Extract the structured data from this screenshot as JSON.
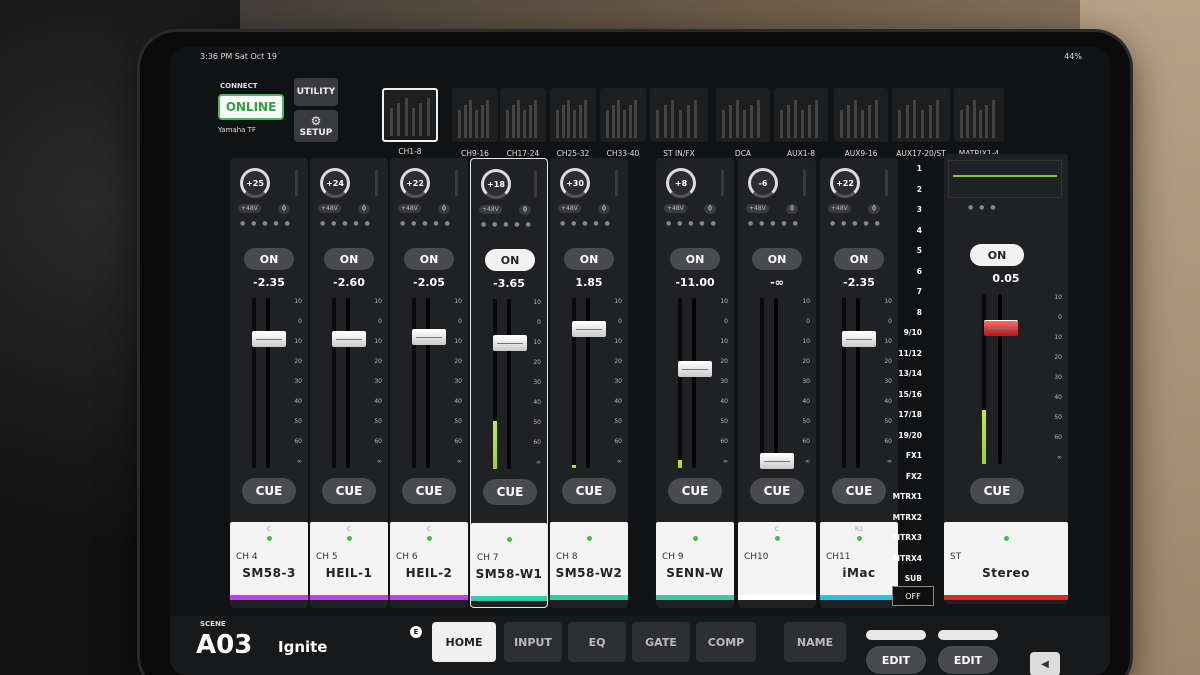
{
  "status": {
    "time": "3:36 PM  Sat Oct 19",
    "battery": "44%"
  },
  "connect": {
    "label": "CONNECT",
    "status": "ONLINE",
    "device": "Yamaha TF"
  },
  "buttons": {
    "utility": "UTILITY",
    "setup": "SETUP"
  },
  "banks": [
    "CH1-8",
    "CH9-16",
    "CH17-24",
    "CH25-32",
    "CH33-40",
    "ST IN/FX",
    "DCA",
    "AUX1-8",
    "AUX9-16",
    "AUX17-20/ST",
    "MATRIX1-4"
  ],
  "channels": [
    {
      "gain": "+25",
      "on": "ON",
      "level": "-2.35",
      "cue": "CUE",
      "pan": "C",
      "num": "CH 4",
      "name": "SM58-3",
      "color": "#c040ff",
      "fader": 0.76,
      "meter": 0.0
    },
    {
      "gain": "+24",
      "on": "ON",
      "level": "-2.60",
      "cue": "CUE",
      "pan": "C",
      "num": "CH 5",
      "name": "HEIL-1",
      "color": "#c040ff",
      "fader": 0.76,
      "meter": 0.0
    },
    {
      "gain": "+22",
      "on": "ON",
      "level": "-2.05",
      "cue": "CUE",
      "pan": "C",
      "num": "CH 6",
      "name": "HEIL-2",
      "color": "#c040ff",
      "fader": 0.77,
      "meter": 0.0
    },
    {
      "gain": "+18",
      "on": "ON",
      "level": "-3.65",
      "cue": "CUE",
      "pan": "",
      "num": "CH 7",
      "name": "SM58-W1",
      "color": "#2fd0a8",
      "fader": 0.74,
      "meter": 0.28
    },
    {
      "gain": "+30",
      "on": "ON",
      "level": "1.85",
      "cue": "CUE",
      "pan": "",
      "num": "CH 8",
      "name": "SM58-W2",
      "color": "#2fd0a8",
      "fader": 0.82,
      "meter": 0.02
    },
    {
      "gain": "+8",
      "on": "ON",
      "level": "-11.00",
      "cue": "CUE",
      "pan": "",
      "num": "CH 9",
      "name": "SENN-W",
      "color": "#2fd0a8",
      "fader": 0.58,
      "meter": 0.05
    },
    {
      "gain": "-6",
      "on": "ON",
      "level": "-∞",
      "cue": "CUE",
      "pan": "C",
      "num": "CH10",
      "name": "",
      "color": "#ffffff",
      "fader": 0.04,
      "meter": 0.0
    },
    {
      "gain": "+22",
      "on": "ON",
      "level": "-2.35",
      "cue": "CUE",
      "pan": "R2",
      "num": "CH11",
      "name": "iMac",
      "color": "#27c6e0",
      "fader": 0.76,
      "meter": 0.0
    }
  ],
  "phantom": "+48V",
  "scale": [
    "10",
    "0",
    "10",
    "20",
    "30",
    "40",
    "50",
    "60",
    "∞"
  ],
  "sends": [
    "1",
    "2",
    "3",
    "4",
    "5",
    "6",
    "7",
    "8",
    "9/10",
    "11/12",
    "13/14",
    "15/16",
    "17/18",
    "19/20",
    "FX1",
    "FX2",
    "MTRX1",
    "MTRX2",
    "MTRX3",
    "MTRX4",
    "SUB"
  ],
  "sends_off": "OFF",
  "master": {
    "on": "ON",
    "level": "0.05",
    "cue": "CUE",
    "num": "ST",
    "name": "Stereo",
    "color": "#e02828",
    "fader": 0.8,
    "meter": 0.32
  },
  "scene": {
    "label": "SCENE",
    "number": "A03",
    "name": "Ignite",
    "badge": "E"
  },
  "tabs": [
    "HOME",
    "INPUT",
    "EQ",
    "GATE",
    "COMP",
    "NAME"
  ],
  "edit": [
    "EDIT",
    "EDIT"
  ]
}
